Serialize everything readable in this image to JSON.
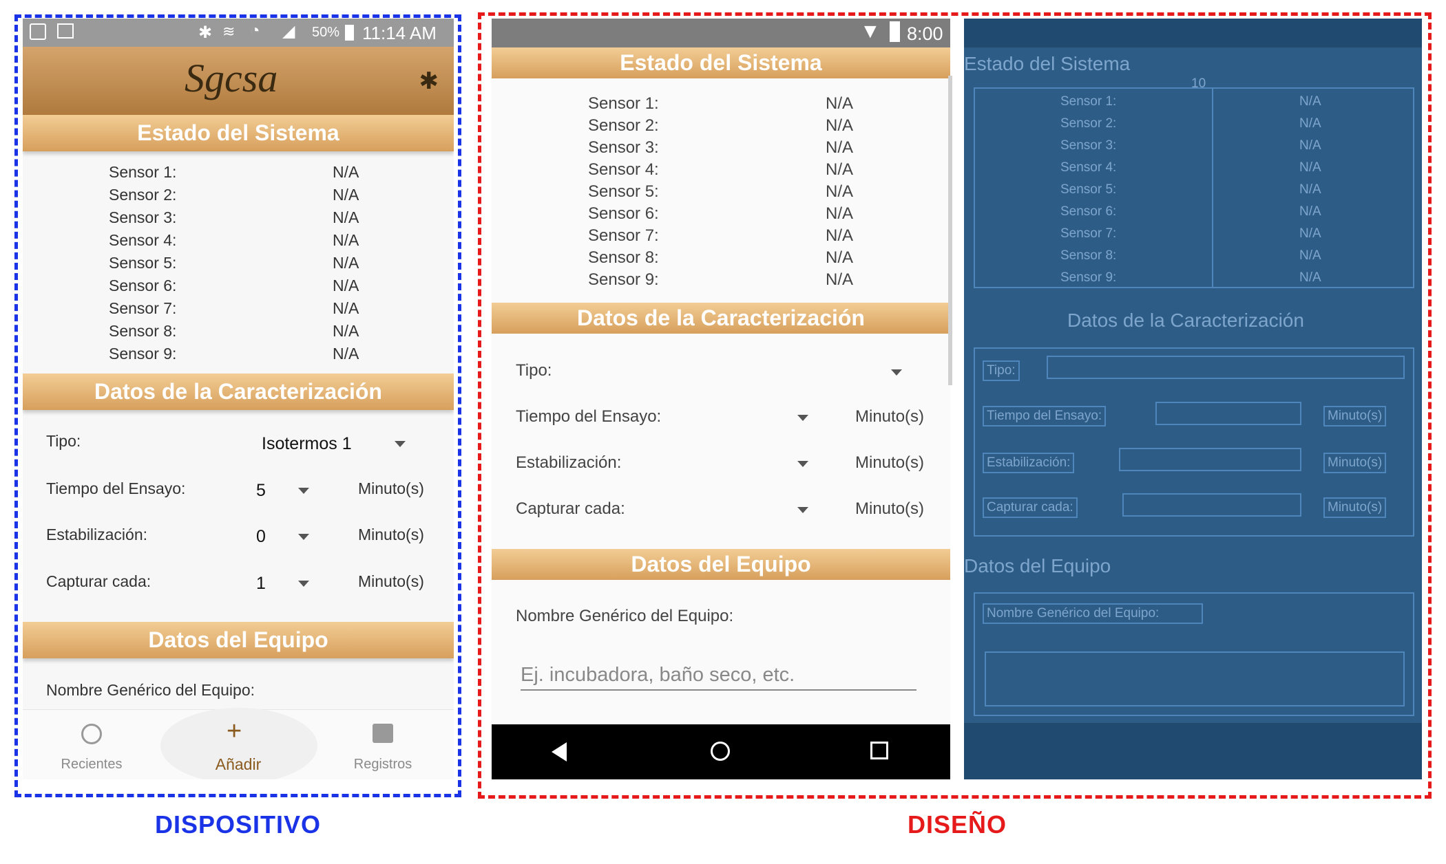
{
  "captions": {
    "device": "DISPOSITIVO",
    "design": "DISEÑO"
  },
  "device": {
    "status": {
      "battery": "50%",
      "time": "11:14 AM"
    },
    "logo": "Sgcsa",
    "sections": {
      "estado": "Estado del Sistema",
      "datos": "Datos de la Caracterización",
      "equipo": "Datos del Equipo"
    },
    "sensors": [
      {
        "label": "Sensor 1:",
        "value": "N/A"
      },
      {
        "label": "Sensor 2:",
        "value": "N/A"
      },
      {
        "label": "Sensor 3:",
        "value": "N/A"
      },
      {
        "label": "Sensor 4:",
        "value": "N/A"
      },
      {
        "label": "Sensor 5:",
        "value": "N/A"
      },
      {
        "label": "Sensor 6:",
        "value": "N/A"
      },
      {
        "label": "Sensor 7:",
        "value": "N/A"
      },
      {
        "label": "Sensor 8:",
        "value": "N/A"
      },
      {
        "label": "Sensor 9:",
        "value": "N/A"
      }
    ],
    "form": {
      "tipo_label": "Tipo:",
      "tipo_value": "Isotermos 1",
      "tiempo_label": "Tiempo del Ensayo:",
      "tiempo_value": "5",
      "estab_label": "Estabilización:",
      "estab_value": "0",
      "captura_label": "Capturar cada:",
      "captura_value": "1",
      "unit": "Minuto(s)",
      "nombre_label": "Nombre Genérico del Equipo:"
    },
    "nav": {
      "recientes": "Recientes",
      "anadir": "Añadir",
      "registros": "Registros"
    }
  },
  "design": {
    "status_time": "8:00",
    "placeholder": "Ej. incubadora, baño seco, etc.",
    "margin_tag": "10"
  },
  "colors": {
    "accent": "#d79f5c",
    "blueprint": "#2d5c87",
    "blue_frame": "#1a33e6",
    "red_frame": "#e61a1a"
  }
}
